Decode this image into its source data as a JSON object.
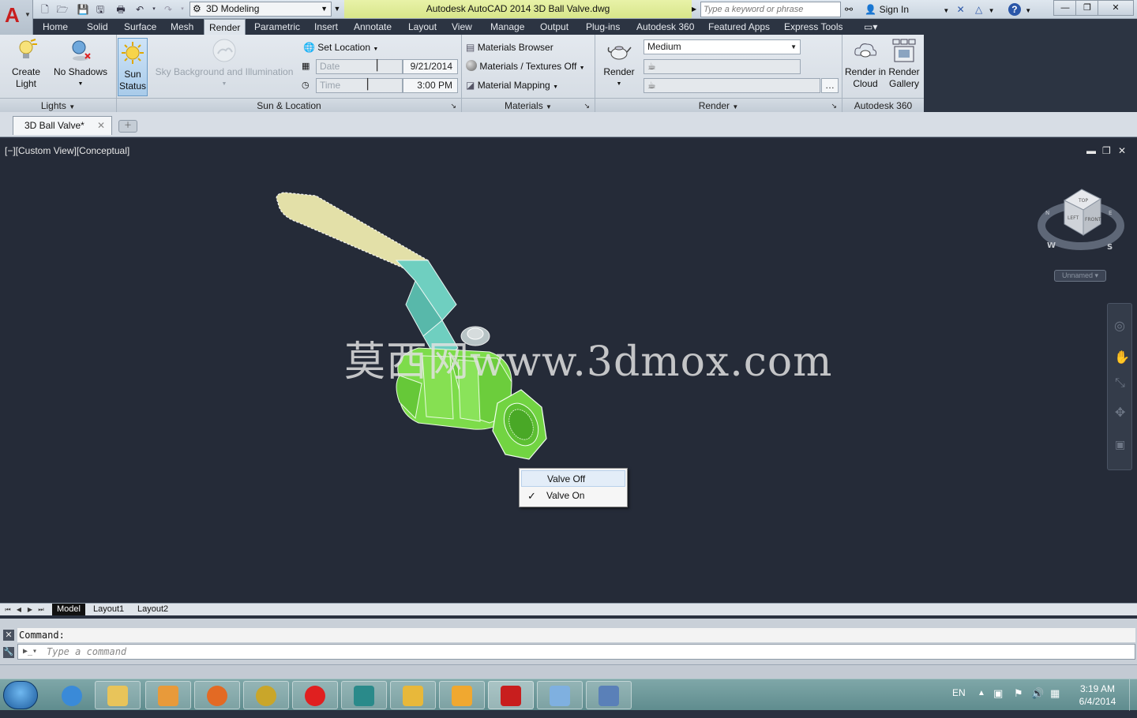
{
  "window": {
    "title": "Autodesk AutoCAD 2014    3D Ball Valve.dwg",
    "workspace": "3D Modeling",
    "search_placeholder": "Type a keyword or phrase",
    "sign_in": "Sign In"
  },
  "menu_tabs": [
    "Home",
    "Solid",
    "Surface",
    "Mesh",
    "Render",
    "Parametric",
    "Insert",
    "Annotate",
    "Layout",
    "View",
    "Manage",
    "Output",
    "Plug-ins",
    "Autodesk 360",
    "Featured Apps",
    "Express Tools"
  ],
  "active_tab": "Render",
  "ribbon": {
    "lights": {
      "create_light_1": "Create",
      "create_light_2": "Light",
      "no_shadows": "No Shadows",
      "title": "Lights"
    },
    "sun": {
      "sun_status_1": "Sun",
      "sun_status_2": "Status",
      "sky": "Sky Background and Illumination",
      "set_location": "Set Location",
      "date_label": "Date",
      "date_value": "9/21/2014",
      "time_label": "Time",
      "time_value": "3:00 PM",
      "title": "Sun & Location"
    },
    "materials": {
      "browser": "Materials Browser",
      "textures": "Materials / Textures Off",
      "mapping": "Material Mapping",
      "title": "Materials"
    },
    "render": {
      "render_btn": "Render",
      "quality": "Medium",
      "title": "Render"
    },
    "a360": {
      "render_cloud_1": "Render in",
      "render_cloud_2": "Cloud",
      "render_gallery_1": "Render",
      "render_gallery_2": "Gallery",
      "title": "Autodesk 360"
    }
  },
  "document_tab": "3D Ball Valve*",
  "viewport": {
    "label": "[−][Custom View][Conceptual]",
    "watermark": "莫西网www.3dmox.com",
    "viewcube_label": "Unnamed",
    "viewcube_top": "TOP",
    "viewcube_left": "LEFT",
    "viewcube_front": "FRONT",
    "compass_w": "W",
    "compass_s": "S",
    "compass_n": "N",
    "compass_e": "E"
  },
  "context_menu": {
    "item1": "Valve Off",
    "item2": "Valve On",
    "checked": "Valve On"
  },
  "layout_tabs": [
    "Model",
    "Layout1",
    "Layout2"
  ],
  "command": {
    "history": "Command:",
    "placeholder": "Type a command"
  },
  "taskbar": {
    "lang": "EN",
    "time": "3:19 AM",
    "date": "6/4/2014"
  },
  "colors": {
    "valve_body": "#7ddc4a",
    "handle_grip": "#e3e0a8",
    "handle_neck": "#6fcfc0",
    "viewport_bg": "#252b38"
  }
}
